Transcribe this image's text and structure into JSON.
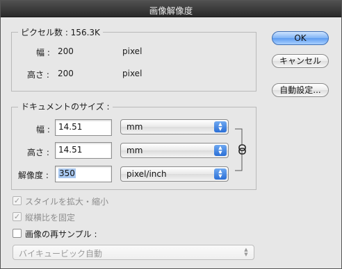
{
  "window": {
    "title": "画像解像度"
  },
  "pixel_size": {
    "legend": "ピクセル数 : 156.3K",
    "width_label": "幅 :",
    "width_value": "200",
    "width_unit": "pixel",
    "height_label": "高さ :",
    "height_value": "200",
    "height_unit": "pixel"
  },
  "document_size": {
    "legend": "ドキュメントのサイズ :",
    "width_label": "幅 :",
    "width_value": "14.51",
    "width_unit": "mm",
    "height_label": "高さ :",
    "height_value": "14.51",
    "height_unit": "mm",
    "resolution_label": "解像度 :",
    "resolution_value": "350",
    "resolution_unit": "pixel/inch"
  },
  "buttons": {
    "ok": "OK",
    "cancel": "キャンセル",
    "auto": "自動設定..."
  },
  "options": {
    "scale_styles": "スタイルを拡大・縮小",
    "constrain": "縦横比を固定",
    "resample": "画像の再サンプル :",
    "resample_method": "バイキュービック自動"
  },
  "colors": {
    "default_button": "#80b4f5",
    "selection": "#a9c8f0"
  }
}
